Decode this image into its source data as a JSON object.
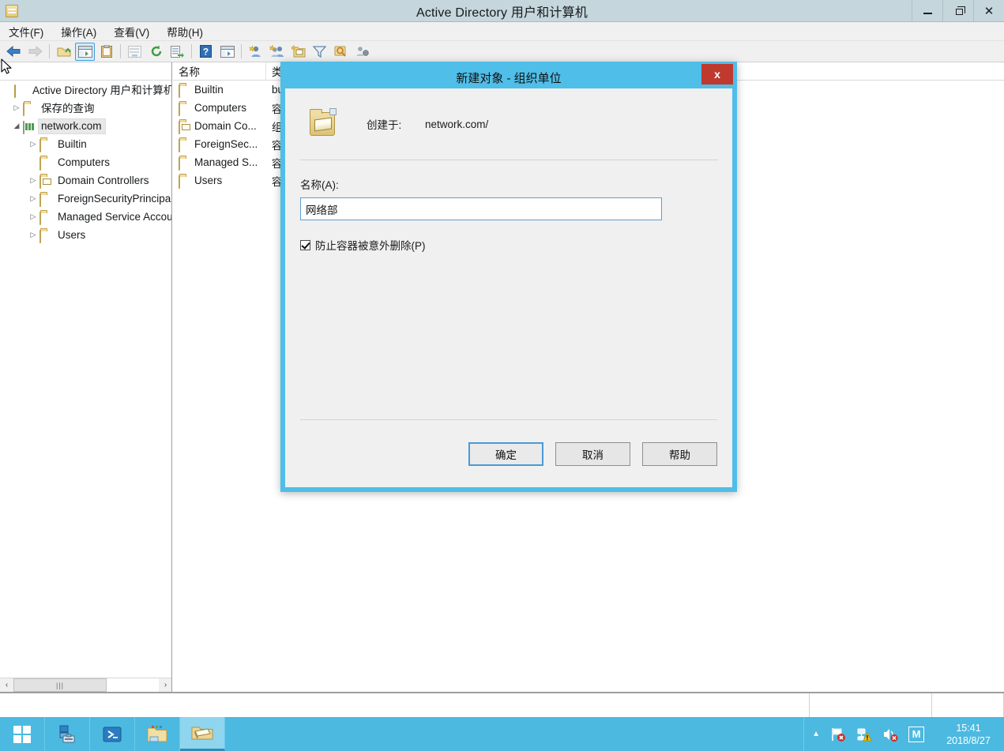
{
  "window": {
    "title": "Active Directory 用户和计算机",
    "icon": "console-icon",
    "controls": {
      "minimize": "最小化",
      "restore": "还原",
      "close": "关闭"
    }
  },
  "menubar": {
    "items": [
      {
        "label": "文件(F)",
        "name": "menu-file"
      },
      {
        "label": "操作(A)",
        "name": "menu-action"
      },
      {
        "label": "查看(V)",
        "name": "menu-view"
      },
      {
        "label": "帮助(H)",
        "name": "menu-help"
      }
    ]
  },
  "toolbar": {
    "buttons": [
      {
        "name": "back-icon",
        "glyph": "back",
        "state": "enabled"
      },
      {
        "name": "forward-icon",
        "glyph": "forward",
        "state": "disabled"
      },
      {
        "name": "up-one-level-icon",
        "glyph": "up-folder",
        "state": "enabled"
      },
      {
        "name": "show-hide-tree-icon",
        "glyph": "tree-pane",
        "state": "active"
      },
      {
        "name": "properties-icon",
        "glyph": "clipboard",
        "state": "enabled"
      },
      {
        "name": "export-list-icon",
        "glyph": "export-list",
        "state": "disabled"
      },
      {
        "name": "refresh-icon",
        "glyph": "refresh",
        "state": "enabled"
      },
      {
        "name": "export-icon",
        "glyph": "export-arrow",
        "state": "enabled"
      },
      {
        "name": "help-icon",
        "glyph": "question",
        "state": "enabled"
      },
      {
        "name": "console-view-icon",
        "glyph": "console-window",
        "state": "enabled"
      },
      {
        "name": "new-user-icon",
        "glyph": "new-user",
        "state": "enabled"
      },
      {
        "name": "new-group-icon",
        "glyph": "new-group",
        "state": "enabled"
      },
      {
        "name": "new-ou-icon",
        "glyph": "new-ou",
        "state": "enabled"
      },
      {
        "name": "filter-icon",
        "glyph": "funnel",
        "state": "enabled"
      },
      {
        "name": "find-icon",
        "glyph": "find",
        "state": "enabled"
      },
      {
        "name": "saved-query-icon",
        "glyph": "query-tool",
        "state": "enabled"
      }
    ]
  },
  "tree": {
    "nodes": [
      {
        "label": "Active Directory 用户和计算机",
        "icon": "console-root-icon",
        "indent": 0,
        "twisty": "none",
        "selected": false
      },
      {
        "label": "保存的查询",
        "icon": "folder-icon",
        "indent": 1,
        "twisty": "collapsed",
        "selected": false
      },
      {
        "label": "network.com",
        "icon": "domain-icon",
        "indent": 1,
        "twisty": "expanded",
        "selected": true
      },
      {
        "label": "Builtin",
        "icon": "folder-icon",
        "indent": 2,
        "twisty": "collapsed",
        "selected": false
      },
      {
        "label": "Computers",
        "icon": "folder-icon",
        "indent": 2,
        "twisty": "none",
        "selected": false
      },
      {
        "label": "Domain Controllers",
        "icon": "ou-folder-icon",
        "indent": 2,
        "twisty": "collapsed",
        "selected": false
      },
      {
        "label": "ForeignSecurityPrincipals",
        "icon": "folder-icon",
        "indent": 2,
        "twisty": "collapsed",
        "selected": false
      },
      {
        "label": "Managed Service Accounts",
        "icon": "folder-icon",
        "indent": 2,
        "twisty": "collapsed",
        "selected": false
      },
      {
        "label": "Users",
        "icon": "folder-icon",
        "indent": 2,
        "twisty": "collapsed",
        "selected": false
      }
    ],
    "hscrollbar": {
      "left_arrow": "‹",
      "right_arrow": "›",
      "grip": "|||"
    }
  },
  "list": {
    "columns": [
      {
        "label": "名称",
        "name": "column-name"
      },
      {
        "label": "类型",
        "name": "column-type"
      }
    ],
    "rows": [
      {
        "name": "Builtin",
        "type": "builtinDomain",
        "icon": "folder-icon"
      },
      {
        "name": "Computers",
        "type": "容器",
        "icon": "folder-icon"
      },
      {
        "name": "Domain Co...",
        "type": "组织单位",
        "icon": "ou-folder-icon"
      },
      {
        "name": "ForeignSec...",
        "type": "容器",
        "icon": "folder-icon"
      },
      {
        "name": "Managed S...",
        "type": "容器",
        "icon": "folder-icon"
      },
      {
        "name": "Users",
        "type": "容器",
        "icon": "folder-icon"
      }
    ]
  },
  "dialog": {
    "title": "新建对象 - 组织单位",
    "close_label": "x",
    "icon": "ou-object-icon",
    "created_in_label": "创建于:",
    "created_in_value": "network.com/",
    "name_label": "名称(A):",
    "name_value": "网络部",
    "name_placeholder": "",
    "protect_checkbox_label": "防止容器被意外删除(P)",
    "protect_checked": true,
    "buttons": {
      "ok": "确定",
      "cancel": "取消",
      "help": "帮助"
    }
  },
  "taskbar": {
    "start": "start-button",
    "items": [
      {
        "name": "taskbar-server-manager",
        "icon": "server-manager-icon",
        "running": false
      },
      {
        "name": "taskbar-powershell",
        "icon": "powershell-icon",
        "running": false
      },
      {
        "name": "taskbar-file-explorer",
        "icon": "file-explorer-icon",
        "running": false
      },
      {
        "name": "taskbar-ad-users-computers",
        "icon": "ou-folder-icon",
        "running": true
      }
    ],
    "tray": [
      {
        "name": "show-hidden-icons-chevron",
        "icon": "chevron-up-icon"
      },
      {
        "name": "action-center-flag",
        "icon": "flag-error-icon"
      },
      {
        "name": "network-status",
        "icon": "network-warning-icon"
      },
      {
        "name": "volume-status",
        "icon": "volume-muted-icon"
      },
      {
        "name": "app-tray-m",
        "icon": "letter-m-icon",
        "label": "M"
      }
    ],
    "clock": {
      "time": "15:41",
      "date": "2018/8/27"
    }
  }
}
